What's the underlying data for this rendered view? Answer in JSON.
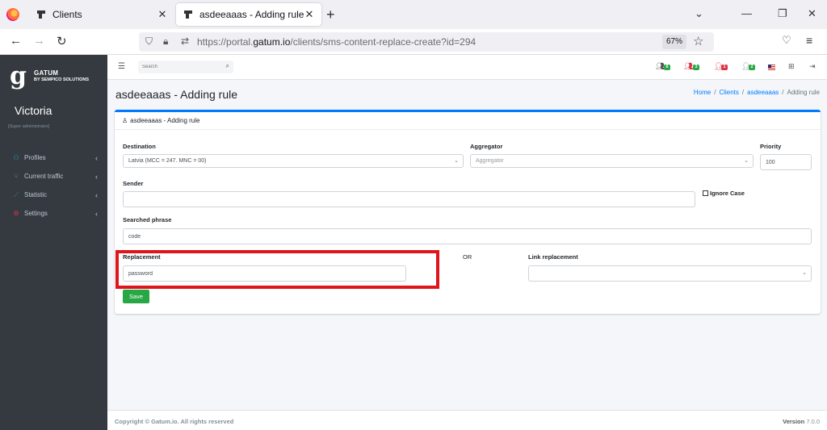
{
  "browser": {
    "tabs": [
      {
        "title": "Clients",
        "active": false
      },
      {
        "title": "asdeeaaas - Adding rule",
        "active": true
      }
    ],
    "url_prefix": "https://portal.",
    "url_domain": "gatum.io",
    "url_path": "/clients/sms-content-replace-create?id=294",
    "zoom": "67%"
  },
  "brand": {
    "mark": "g",
    "name": "GATUM",
    "tagline": "BY SEMPICO SOLUTIONS"
  },
  "user": {
    "name": "Victoria",
    "role": "[Super administrator]"
  },
  "sidebar": {
    "items": [
      {
        "label": "Profiles",
        "icon": "share-icon",
        "color": "#17a2b8"
      },
      {
        "label": "Current traffic",
        "icon": "fork-icon",
        "color": "#17a2b8"
      },
      {
        "label": "Statistic",
        "icon": "chart-icon",
        "color": "#28a745"
      },
      {
        "label": "Settings",
        "icon": "cogs-icon",
        "color": "#dc3545"
      }
    ]
  },
  "topbar": {
    "search_placeholder": "Search",
    "badges": [
      {
        "icon": "users-icon",
        "count": "6",
        "color": "#28a745"
      },
      {
        "icon": "users-icon",
        "count": "3",
        "color": "#28a745"
      },
      {
        "icon": "user-icon",
        "count": "1",
        "color": "#dc3545"
      },
      {
        "icon": "user-icon",
        "count": "2",
        "color": "#28a745"
      }
    ]
  },
  "page": {
    "title": "asdeeaaas - Adding rule",
    "breadcrumb": {
      "home": "Home",
      "clients": "Clients",
      "client": "asdeeaaas",
      "current": "Adding rule"
    }
  },
  "form": {
    "header": "asdeeaaas - Adding rule",
    "destination_label": "Destination",
    "destination_value": "Latvia (MCC = 247. MNC = 00)",
    "aggregator_label": "Aggregator",
    "aggregator_placeholder": "Aggregator",
    "priority_label": "Priority",
    "priority_value": "100",
    "sender_label": "Sender",
    "sender_value": "",
    "ignore_case_label": "Ignore Case",
    "searched_phrase_label": "Searched phrase",
    "searched_phrase_value": "code",
    "replacement_label": "Replacement",
    "replacement_value": "password",
    "or_text": "OR",
    "link_replacement_label": "Link replacement",
    "link_replacement_value": "",
    "save_label": "Save"
  },
  "footer": {
    "copyright": "Copyright © Gatum.io. All rights reserved",
    "version_label": "Version",
    "version_value": "7.0.0"
  },
  "colors": {
    "accent": "#007bff",
    "success": "#28a745",
    "highlight": "#e0141b",
    "sidebar_bg": "#343a40"
  }
}
